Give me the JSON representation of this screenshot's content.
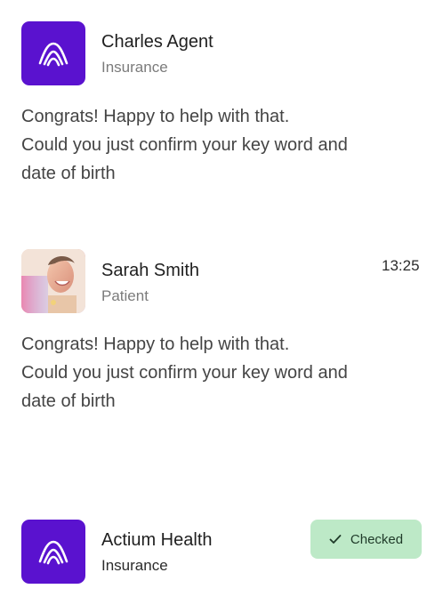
{
  "contacts": [
    {
      "name": "Charles Agent",
      "role": "Insurance",
      "avatar_icon": "brand-logo-icon",
      "message_lines": [
        "Congrats! Happy to help with that.",
        "Could you just confirm your key word and",
        "date of birth"
      ]
    },
    {
      "name": "Sarah Smith",
      "role": "Patient",
      "time": "13:25",
      "avatar_icon": "profile-photo",
      "message_lines": [
        "Congrats! Happy to help with that.",
        "Could you just confirm your key word and",
        "date of birth"
      ]
    },
    {
      "name": "Actium Health",
      "role": "Insurance",
      "avatar_icon": "brand-logo-icon",
      "badge": {
        "label": "Checked",
        "icon": "check-icon"
      }
    }
  ],
  "colors": {
    "brand": "#5a12cf",
    "badge_bg": "#bde9c7",
    "badge_text": "#1f3a29"
  }
}
